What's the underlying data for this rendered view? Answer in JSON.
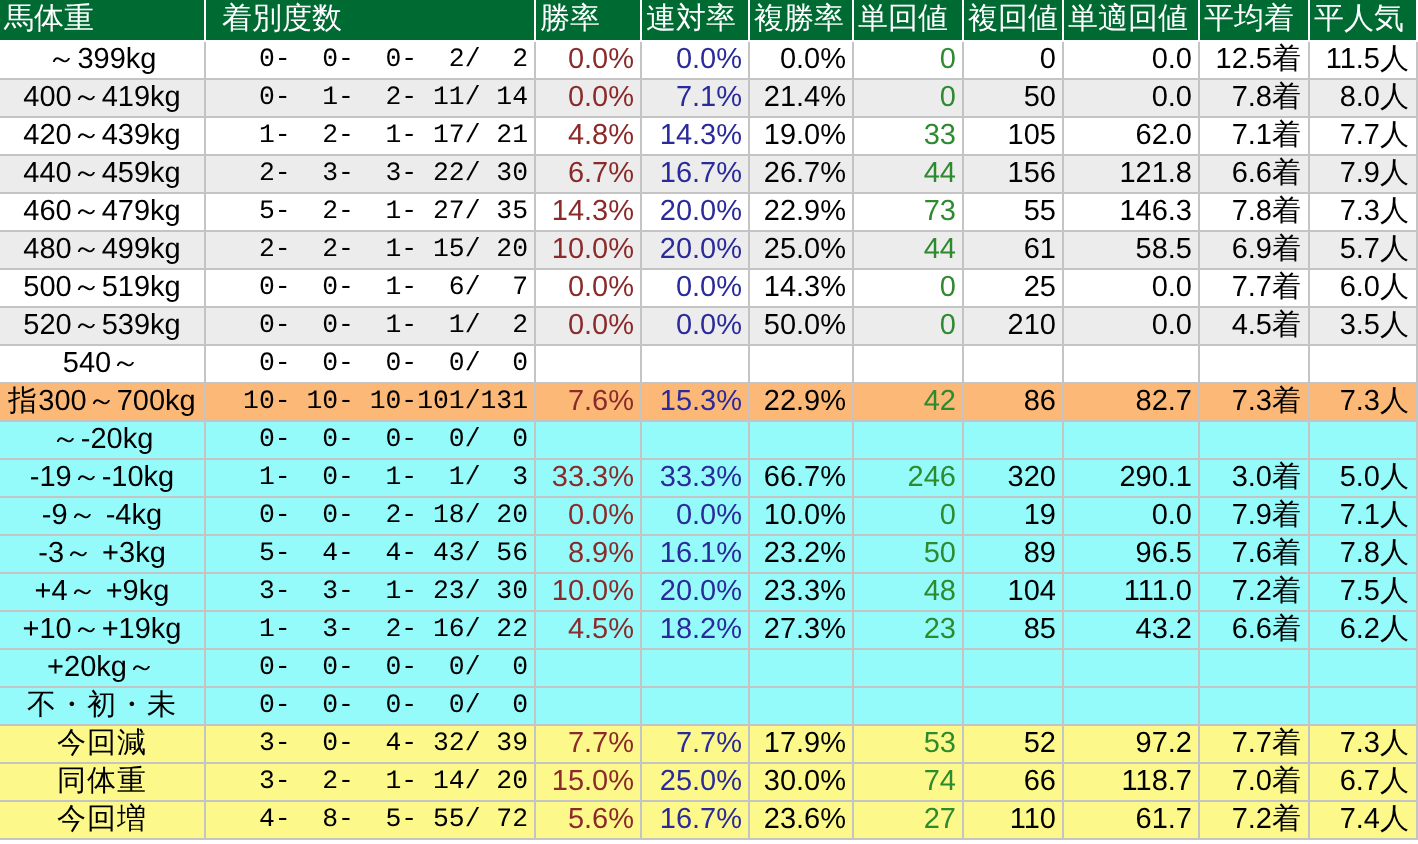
{
  "table": {
    "columns": [
      "馬体重",
      "着別度数",
      "勝率",
      "連対率",
      "複勝率",
      "単回値",
      "複回値",
      "単適回値",
      "平均着",
      "平人気"
    ],
    "rows": [
      {
        "kind": "white",
        "label": "～399kg",
        "record": " 0-  0-  0-  2/  2",
        "win": "0.0%",
        "top2": "0.0%",
        "top3": "0.0%",
        "win_return": "0",
        "place_return": "0",
        "adj_return": "0.0",
        "avg_finish": "12.5着",
        "avg_pop": "11.5人"
      },
      {
        "kind": "gray",
        "label": "400～419kg",
        "record": " 0-  1-  2- 11/ 14",
        "win": "0.0%",
        "top2": "7.1%",
        "top3": "21.4%",
        "win_return": "0",
        "place_return": "50",
        "adj_return": "0.0",
        "avg_finish": "7.8着",
        "avg_pop": "8.0人"
      },
      {
        "kind": "white",
        "label": "420～439kg",
        "record": " 1-  2-  1- 17/ 21",
        "win": "4.8%",
        "top2": "14.3%",
        "top3": "19.0%",
        "win_return": "33",
        "place_return": "105",
        "adj_return": "62.0",
        "avg_finish": "7.1着",
        "avg_pop": "7.7人"
      },
      {
        "kind": "gray",
        "label": "440～459kg",
        "record": " 2-  3-  3- 22/ 30",
        "win": "6.7%",
        "top2": "16.7%",
        "top3": "26.7%",
        "win_return": "44",
        "place_return": "156",
        "adj_return": "121.8",
        "avg_finish": "6.6着",
        "avg_pop": "7.9人"
      },
      {
        "kind": "white",
        "label": "460～479kg",
        "record": " 5-  2-  1- 27/ 35",
        "win": "14.3%",
        "top2": "20.0%",
        "top3": "22.9%",
        "win_return": "73",
        "place_return": "55",
        "adj_return": "146.3",
        "avg_finish": "7.8着",
        "avg_pop": "7.3人"
      },
      {
        "kind": "gray",
        "label": "480～499kg",
        "record": " 2-  2-  1- 15/ 20",
        "win": "10.0%",
        "top2": "20.0%",
        "top3": "25.0%",
        "win_return": "44",
        "place_return": "61",
        "adj_return": "58.5",
        "avg_finish": "6.9着",
        "avg_pop": "5.7人"
      },
      {
        "kind": "white",
        "label": "500～519kg",
        "record": " 0-  0-  1-  6/  7",
        "win": "0.0%",
        "top2": "0.0%",
        "top3": "14.3%",
        "win_return": "0",
        "place_return": "25",
        "adj_return": "0.0",
        "avg_finish": "7.7着",
        "avg_pop": "6.0人"
      },
      {
        "kind": "gray",
        "label": "520～539kg",
        "record": " 0-  0-  1-  1/  2",
        "win": "0.0%",
        "top2": "0.0%",
        "top3": "50.0%",
        "win_return": "0",
        "place_return": "210",
        "adj_return": "0.0",
        "avg_finish": "4.5着",
        "avg_pop": "3.5人"
      },
      {
        "kind": "white",
        "label": "540～",
        "record": " 0-  0-  0-  0/  0"
      },
      {
        "kind": "orange",
        "label": "指300～700kg",
        "record": "10- 10- 10-101/131",
        "win": "7.6%",
        "top2": "15.3%",
        "top3": "22.9%",
        "win_return": "42",
        "place_return": "86",
        "adj_return": "82.7",
        "avg_finish": "7.3着",
        "avg_pop": "7.3人"
      },
      {
        "kind": "cyan",
        "label": "～-20kg",
        "record": " 0-  0-  0-  0/  0"
      },
      {
        "kind": "cyan",
        "label": "-19～-10kg",
        "record": " 1-  0-  1-  1/  3",
        "win": "33.3%",
        "top2": "33.3%",
        "top3": "66.7%",
        "win_return": "246",
        "place_return": "320",
        "adj_return": "290.1",
        "avg_finish": "3.0着",
        "avg_pop": "5.0人"
      },
      {
        "kind": "cyan",
        "label": "-9～ -4kg",
        "record": " 0-  0-  2- 18/ 20",
        "win": "0.0%",
        "top2": "0.0%",
        "top3": "10.0%",
        "win_return": "0",
        "place_return": "19",
        "adj_return": "0.0",
        "avg_finish": "7.9着",
        "avg_pop": "7.1人"
      },
      {
        "kind": "cyan",
        "label": "-3～ +3kg",
        "record": " 5-  4-  4- 43/ 56",
        "win": "8.9%",
        "top2": "16.1%",
        "top3": "23.2%",
        "win_return": "50",
        "place_return": "89",
        "adj_return": "96.5",
        "avg_finish": "7.6着",
        "avg_pop": "7.8人"
      },
      {
        "kind": "cyan",
        "label": "+4～ +9kg",
        "record": " 3-  3-  1- 23/ 30",
        "win": "10.0%",
        "top2": "20.0%",
        "top3": "23.3%",
        "win_return": "48",
        "place_return": "104",
        "adj_return": "111.0",
        "avg_finish": "7.2着",
        "avg_pop": "7.5人"
      },
      {
        "kind": "cyan",
        "label": "+10～+19kg",
        "record": " 1-  3-  2- 16/ 22",
        "win": "4.5%",
        "top2": "18.2%",
        "top3": "27.3%",
        "win_return": "23",
        "place_return": "85",
        "adj_return": "43.2",
        "avg_finish": "6.6着",
        "avg_pop": "6.2人"
      },
      {
        "kind": "cyan",
        "label": "+20kg～",
        "record": " 0-  0-  0-  0/  0"
      },
      {
        "kind": "cyan",
        "label": "不・初・未",
        "record": " 0-  0-  0-  0/  0"
      },
      {
        "kind": "yellow",
        "label": "今回減",
        "record": " 3-  0-  4- 32/ 39",
        "win": "7.7%",
        "top2": "7.7%",
        "top3": "17.9%",
        "win_return": "53",
        "place_return": "52",
        "adj_return": "97.2",
        "avg_finish": "7.7着",
        "avg_pop": "7.3人"
      },
      {
        "kind": "yellow",
        "label": "同体重",
        "record": " 3-  2-  1- 14/ 20",
        "win": "15.0%",
        "top2": "25.0%",
        "top3": "30.0%",
        "win_return": "74",
        "place_return": "66",
        "adj_return": "118.7",
        "avg_finish": "7.0着",
        "avg_pop": "6.7人"
      },
      {
        "kind": "yellow",
        "label": "今回増",
        "record": " 4-  8-  5- 55/ 72",
        "win": "5.6%",
        "top2": "16.7%",
        "top3": "23.6%",
        "win_return": "27",
        "place_return": "110",
        "adj_return": "61.7",
        "avg_finish": "7.2着",
        "avg_pop": "7.4人"
      }
    ]
  }
}
